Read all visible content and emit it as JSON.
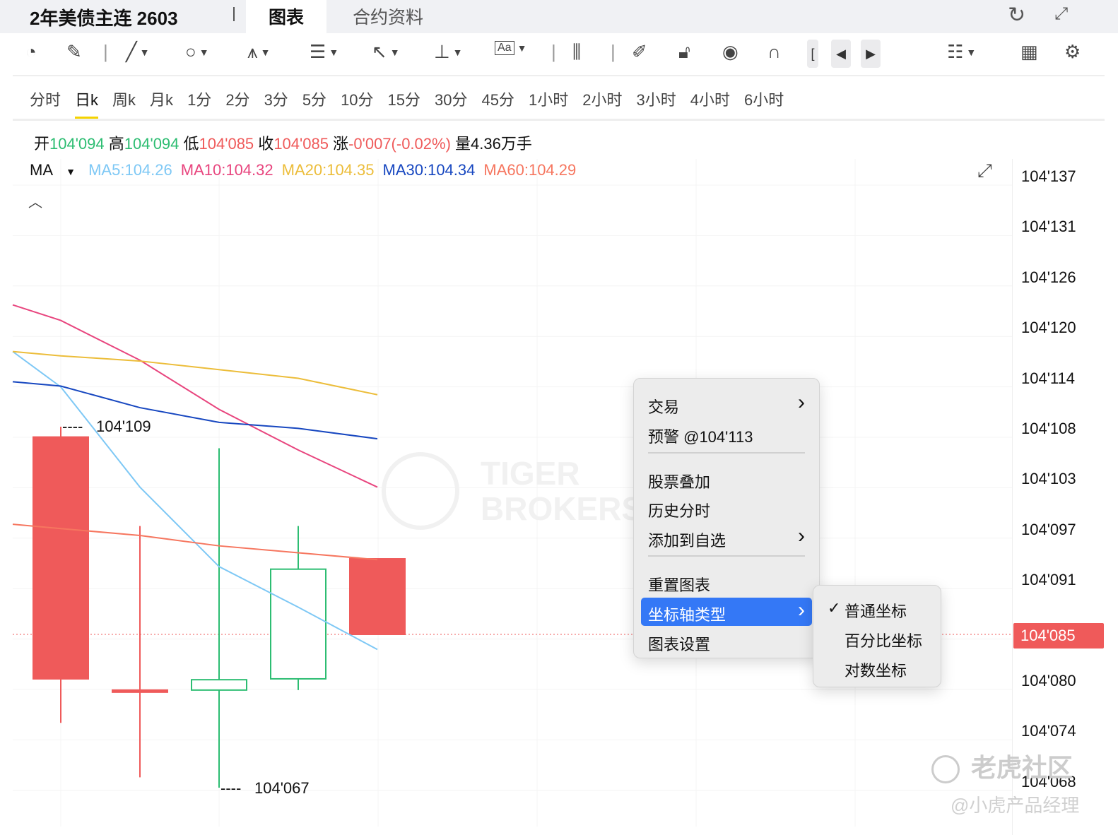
{
  "header": {
    "title": "2年美债主连 2603",
    "tabs": [
      "图表",
      "合约资料"
    ]
  },
  "toolbar": {
    "icons": [
      "speed-icon",
      "edit-icon",
      "line-icon",
      "circle-icon",
      "pattern-icon",
      "fib-icon",
      "arrow-icon",
      "measure-icon",
      "text-icon",
      "candle-type-icon",
      "pen-icon",
      "unlock-icon",
      "eye-icon",
      "magnet-icon"
    ]
  },
  "periods": [
    "分时",
    "日k",
    "周k",
    "月k",
    "1分",
    "2分",
    "3分",
    "5分",
    "10分",
    "15分",
    "30分",
    "45分",
    "1小时",
    "2小时",
    "3小时",
    "4小时",
    "6小时"
  ],
  "active_period": "日k",
  "quote": {
    "open_label": "开",
    "open": "104'094",
    "high_label": "高",
    "high": "104'094",
    "low_label": "低",
    "low": "104'085",
    "close_label": "收",
    "close": "104'085",
    "change_label": "涨",
    "change": "-0'007(-0.02%)",
    "volume_label": "量",
    "volume": "4.36万手"
  },
  "ma": {
    "label": "MA",
    "items": [
      {
        "text": "MA5:104.26",
        "color": "#7ec8f5"
      },
      {
        "text": "MA10:104.32",
        "color": "#e8457e"
      },
      {
        "text": "MA20:104.35",
        "color": "#ecbd3a"
      },
      {
        "text": "MA30:104.34",
        "color": "#1747c0"
      },
      {
        "text": "MA60:104.29",
        "color": "#f6765f"
      }
    ]
  },
  "axis_labels": [
    "104'137",
    "104'131",
    "104'126",
    "104'120",
    "104'114",
    "104'108",
    "104'103",
    "104'097",
    "104'091",
    "104'085",
    "104'080",
    "104'074",
    "104'068"
  ],
  "current_price": "104'085",
  "chart_data": {
    "type": "candlestick",
    "units": "32nds above 104",
    "ylim": [
      6.4,
      14.13
    ],
    "candles": [
      {
        "o": 10.91,
        "h": 11.03,
        "l": 7.6,
        "c": 8.11
      },
      {
        "o": 7.98,
        "h": 9.88,
        "l": 6.97,
        "c": 7.98
      },
      {
        "o": 7.98,
        "h": 10.78,
        "l": 6.85,
        "c": 8.1
      },
      {
        "o": 8.11,
        "h": 9.88,
        "l": 7.98,
        "c": 9.38
      },
      {
        "o": 9.5,
        "h": 9.5,
        "l": 8.625,
        "c": 8.625
      }
    ],
    "ma_x": [
      -0.6,
      0,
      1,
      2,
      3,
      4
    ],
    "ma_series": [
      {
        "name": "MA5",
        "color": "#7ec8f5",
        "values": [
          11.9,
          11.49,
          10.33,
          9.41,
          8.94,
          8.45
        ]
      },
      {
        "name": "MA10",
        "color": "#e8457e",
        "values": [
          12.44,
          12.26,
          11.8,
          11.23,
          10.76,
          10.33
        ]
      },
      {
        "name": "MA20",
        "color": "#ecbd3a",
        "values": [
          11.9,
          11.85,
          11.79,
          11.69,
          11.59,
          11.4
        ]
      },
      {
        "name": "MA30",
        "color": "#1747c0",
        "values": [
          11.55,
          11.5,
          11.25,
          11.08,
          11.01,
          10.89
        ]
      },
      {
        "name": "MA60",
        "color": "#f6765f",
        "values": [
          9.9,
          9.85,
          9.77,
          9.65,
          9.57,
          9.49
        ]
      }
    ],
    "annotations": {
      "high": "104'109",
      "low": "104'067"
    },
    "up_color": "#2dbd72",
    "down_color": "#ef5a5a"
  },
  "context_menu": {
    "items": [
      {
        "label": "交易",
        "submenu": true
      },
      {
        "label": "预警 @104'113"
      },
      {
        "label": "股票叠加"
      },
      {
        "label": "历史分时"
      },
      {
        "label": "添加到自选",
        "submenu": true
      },
      {
        "label": "重置图表"
      },
      {
        "label": "坐标轴类型",
        "submenu": true,
        "highlighted": true
      },
      {
        "label": "图表设置"
      }
    ]
  },
  "submenu": {
    "items": [
      {
        "label": "普通坐标",
        "checked": true
      },
      {
        "label": "百分比坐标"
      },
      {
        "label": "对数坐标"
      }
    ]
  },
  "watermarks": {
    "brand": "TIGER BROKERS",
    "community": "老虎社区",
    "author": "@小虎产品经理"
  }
}
